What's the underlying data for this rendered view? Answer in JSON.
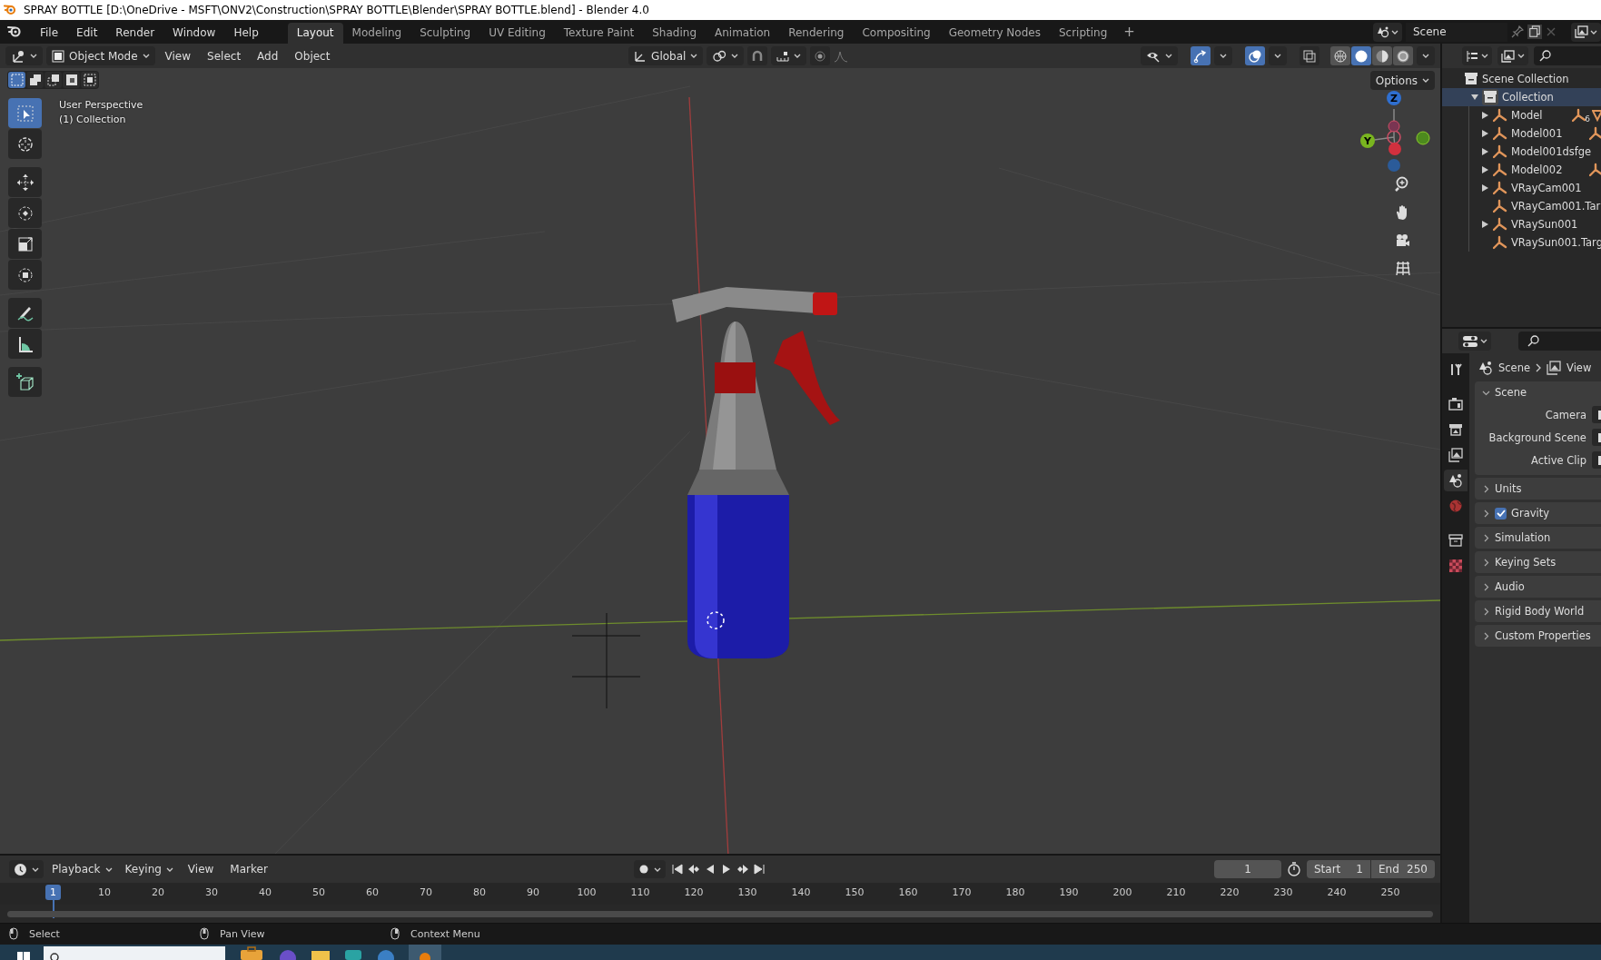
{
  "window": {
    "title": "SPRAY BOTTLE [D:\\OneDrive - MSFT\\ONV2\\Construction\\SPRAY BOTTLE\\Blender\\SPRAY BOTTLE.blend] - Blender 4.0"
  },
  "menu": [
    "File",
    "Edit",
    "Render",
    "Window",
    "Help"
  ],
  "workspaces": [
    {
      "label": "Layout",
      "selected": true
    },
    {
      "label": "Modeling",
      "selected": false
    },
    {
      "label": "Sculpting",
      "selected": false
    },
    {
      "label": "UV Editing",
      "selected": false
    },
    {
      "label": "Texture Paint",
      "selected": false
    },
    {
      "label": "Shading",
      "selected": false
    },
    {
      "label": "Animation",
      "selected": false
    },
    {
      "label": "Rendering",
      "selected": false
    },
    {
      "label": "Compositing",
      "selected": false
    },
    {
      "label": "Geometry Nodes",
      "selected": false
    },
    {
      "label": "Scripting",
      "selected": false
    }
  ],
  "add_workspace": "+",
  "scene_selector": {
    "value": "Scene"
  },
  "viewport": {
    "select_modes": [
      {
        "selected": true
      },
      {
        "selected": false
      },
      {
        "selected": false
      },
      {
        "selected": false
      },
      {
        "selected": false
      }
    ],
    "mode": "Object Mode",
    "menus": [
      "View",
      "Select",
      "Add",
      "Object"
    ],
    "orientation": "Global",
    "shading": [
      {
        "selected": false
      },
      {
        "selected": true
      },
      {
        "selected": false
      },
      {
        "selected": false
      }
    ],
    "options": "Options",
    "overlay_text": [
      "User Perspective",
      "(1) Collection"
    ],
    "tools": [
      {
        "selected": true
      },
      {
        "selected": false
      },
      {
        "selected": false
      },
      {
        "selected": false
      },
      {
        "selected": false
      },
      {
        "selected": false
      },
      {
        "selected": false
      },
      {
        "selected": false
      },
      {
        "selected": false
      }
    ],
    "axis_labels": [
      "Z",
      "Y"
    ]
  },
  "outliner": {
    "root": "Scene Collection",
    "items": [
      {
        "label": "Collection",
        "selected": true,
        "expanded": true,
        "children": [
          {
            "label": "Model",
            "kind": "group",
            "data_icon": true,
            "count": "6"
          },
          {
            "label": "Model001",
            "kind": "group",
            "data_icon": true
          },
          {
            "label": "Model001dsfge",
            "kind": "group",
            "data_icon": false
          },
          {
            "label": "Model002",
            "kind": "group",
            "data_icon": true
          },
          {
            "label": "VRayCam001",
            "kind": "group",
            "data_icon": false
          },
          {
            "label": "VRayCam001.Tar",
            "kind": "leaf",
            "data_icon": false
          },
          {
            "label": "VRaySun001",
            "kind": "group",
            "data_icon": false
          },
          {
            "label": "VRaySun001.Targ",
            "kind": "leaf",
            "data_icon": false
          }
        ]
      }
    ]
  },
  "properties": {
    "tabs": [
      {
        "selected": false
      },
      {
        "selected": false
      },
      {
        "selected": false
      },
      {
        "selected": false
      },
      {
        "selected": true
      },
      {
        "selected": false
      },
      {
        "selected": false
      },
      {
        "selected": false
      }
    ],
    "breadcrumb": [
      "Scene",
      "View"
    ],
    "panels": [
      {
        "title": "Scene",
        "expanded": true,
        "fields": [
          "Camera",
          "Background Scene",
          "Active Clip"
        ]
      },
      {
        "title": "Units",
        "expanded": false
      },
      {
        "title": "Gravity",
        "expanded": false,
        "checked": true
      },
      {
        "title": "Simulation",
        "expanded": false
      },
      {
        "title": "Keying Sets",
        "expanded": false
      },
      {
        "title": "Audio",
        "expanded": false
      },
      {
        "title": "Rigid Body World",
        "expanded": false
      },
      {
        "title": "Custom Properties",
        "expanded": false
      }
    ]
  },
  "timeline": {
    "menus": [
      "Playback",
      "Keying",
      "View",
      "Marker"
    ],
    "current_frame": "1",
    "start": {
      "label": "Start",
      "value": "1"
    },
    "end": {
      "label": "End",
      "value": "250"
    },
    "playhead": "1",
    "ticks": [
      "10",
      "20",
      "30",
      "40",
      "50",
      "60",
      "70",
      "80",
      "90",
      "100",
      "110",
      "120",
      "130",
      "140",
      "150",
      "160",
      "170",
      "180",
      "190",
      "200",
      "210",
      "220",
      "230",
      "240",
      "250"
    ]
  },
  "status_bar": [
    "Select",
    "Pan View",
    "Context Menu"
  ]
}
